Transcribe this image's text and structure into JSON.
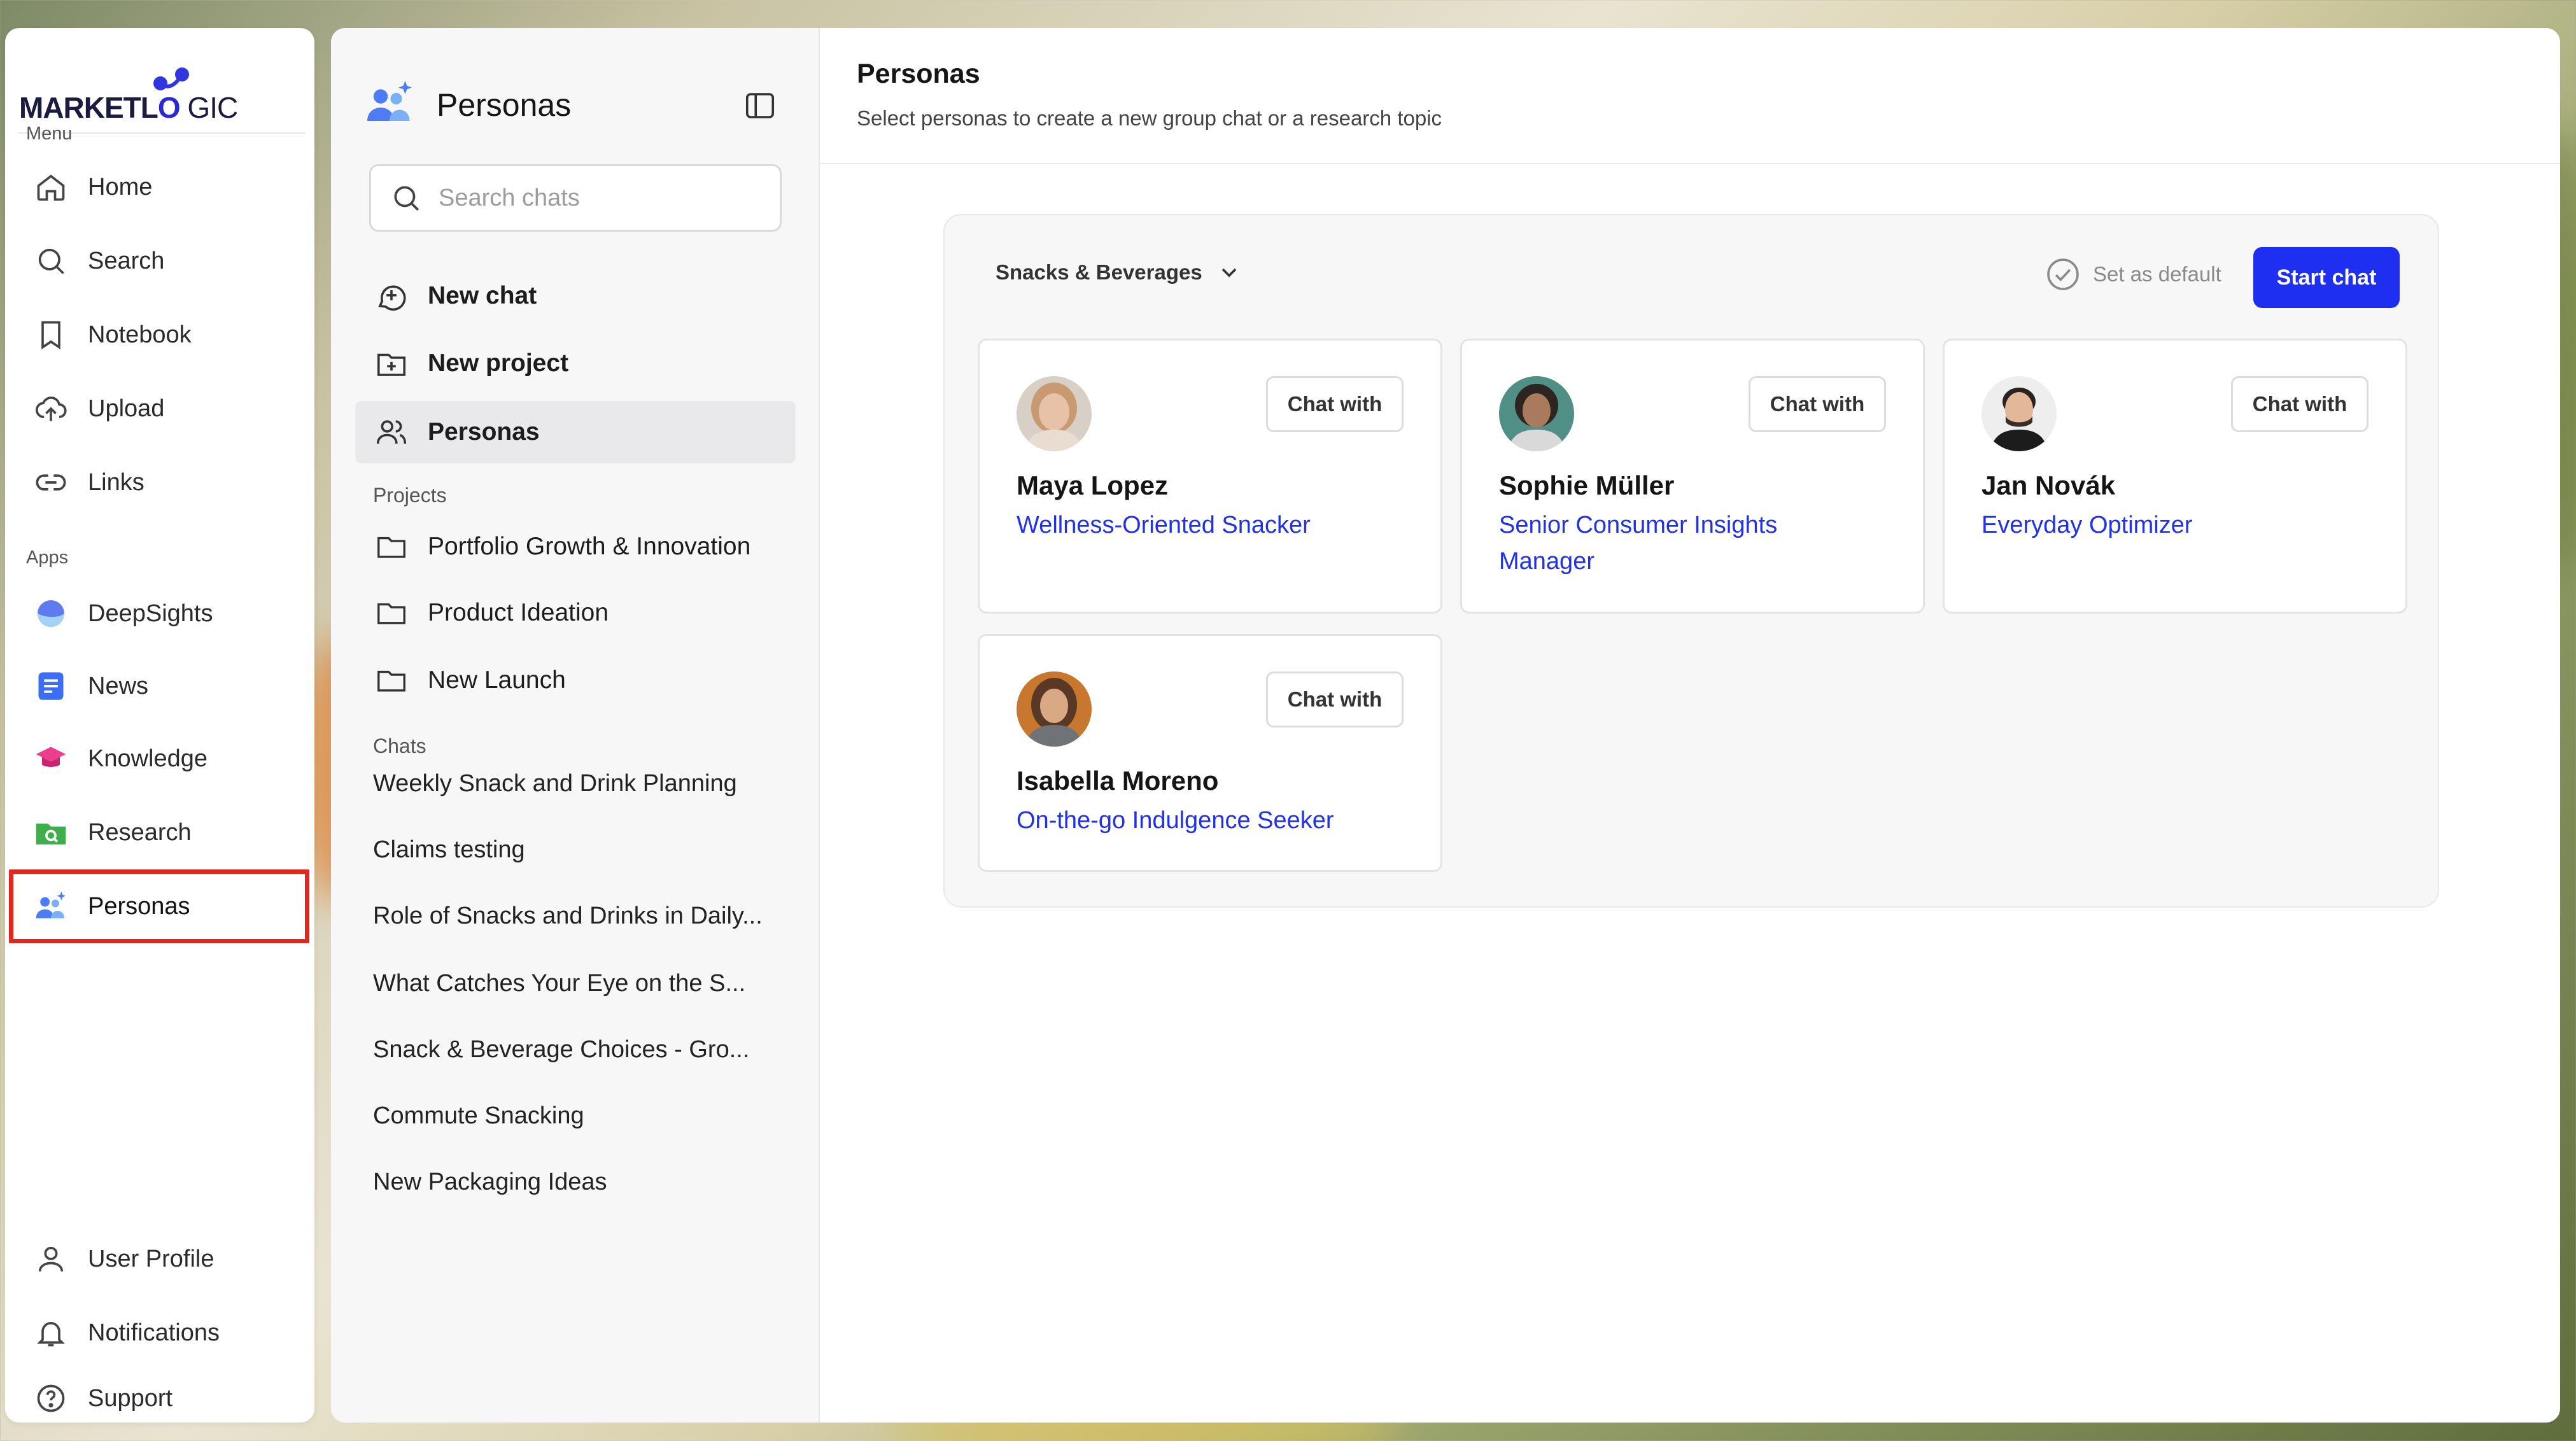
{
  "logo": {
    "bold": "MARKETL",
    "o": "O",
    "thin": "GIC"
  },
  "rail": {
    "menu_label": "Menu",
    "apps_label": "Apps",
    "items": [
      {
        "label": "Home",
        "icon": "home-icon"
      },
      {
        "label": "Search",
        "icon": "search-icon"
      },
      {
        "label": "Notebook",
        "icon": "bookmark-icon"
      },
      {
        "label": "Upload",
        "icon": "upload-icon"
      },
      {
        "label": "Links",
        "icon": "link-icon"
      }
    ],
    "apps": [
      {
        "label": "DeepSights",
        "icon": "deepsights-icon"
      },
      {
        "label": "News",
        "icon": "news-icon"
      },
      {
        "label": "Knowledge",
        "icon": "knowledge-icon"
      },
      {
        "label": "Research",
        "icon": "research-icon"
      },
      {
        "label": "Personas",
        "icon": "personas-icon"
      }
    ],
    "footer": [
      {
        "label": "User Profile",
        "icon": "user-icon"
      },
      {
        "label": "Notifications",
        "icon": "bell-icon"
      },
      {
        "label": "Support",
        "icon": "help-icon"
      }
    ]
  },
  "panel": {
    "title": "Personas",
    "search_placeholder": "Search chats",
    "actions": [
      {
        "label": "New chat"
      },
      {
        "label": "New project"
      },
      {
        "label": "Personas"
      }
    ],
    "projects_label": "Projects",
    "projects": [
      "Portfolio Growth & Innovation",
      "Product Ideation",
      "New Launch"
    ],
    "chats_label": "Chats",
    "chats": [
      "Weekly Snack and Drink Planning",
      "Claims testing",
      "Role of Snacks and Drinks in Daily...",
      "What Catches Your Eye on the S...",
      "Snack & Beverage Choices - Gro...",
      "Commute Snacking",
      "New Packaging Ideas"
    ]
  },
  "main": {
    "title": "Personas",
    "subtitle": "Select personas to create a new group chat or a research topic",
    "category": "Snacks & Beverages",
    "set_default": "Set as default",
    "start_chat": "Start chat",
    "chat_with": "Chat with",
    "personas": [
      {
        "name": "Maya Lopez",
        "role": "Wellness-Oriented Snacker",
        "skin": "#e8c2a8",
        "hair": "#c99a72",
        "shirt": "#e9ddd2"
      },
      {
        "name": "Sophie Müller",
        "role": "Senior Consumer Insights Manager",
        "skin": "#a97b5c",
        "hair": "#2e2420",
        "shirt": "#d9d9d9"
      },
      {
        "name": "Jan Novák",
        "role": "Everyday Optimizer",
        "skin": "#e2b898",
        "hair": "#2b2220",
        "shirt": "#1c1c1c"
      },
      {
        "name": "Isabella Moreno",
        "role": "On-the-go Indulgence Seeker",
        "skin": "#d9a884",
        "hair": "#5a3826",
        "shirt": "#6f7378"
      }
    ]
  },
  "colors": {
    "accent": "#1f2ff2",
    "link": "#2131e6",
    "highlight": "#e0281c"
  }
}
